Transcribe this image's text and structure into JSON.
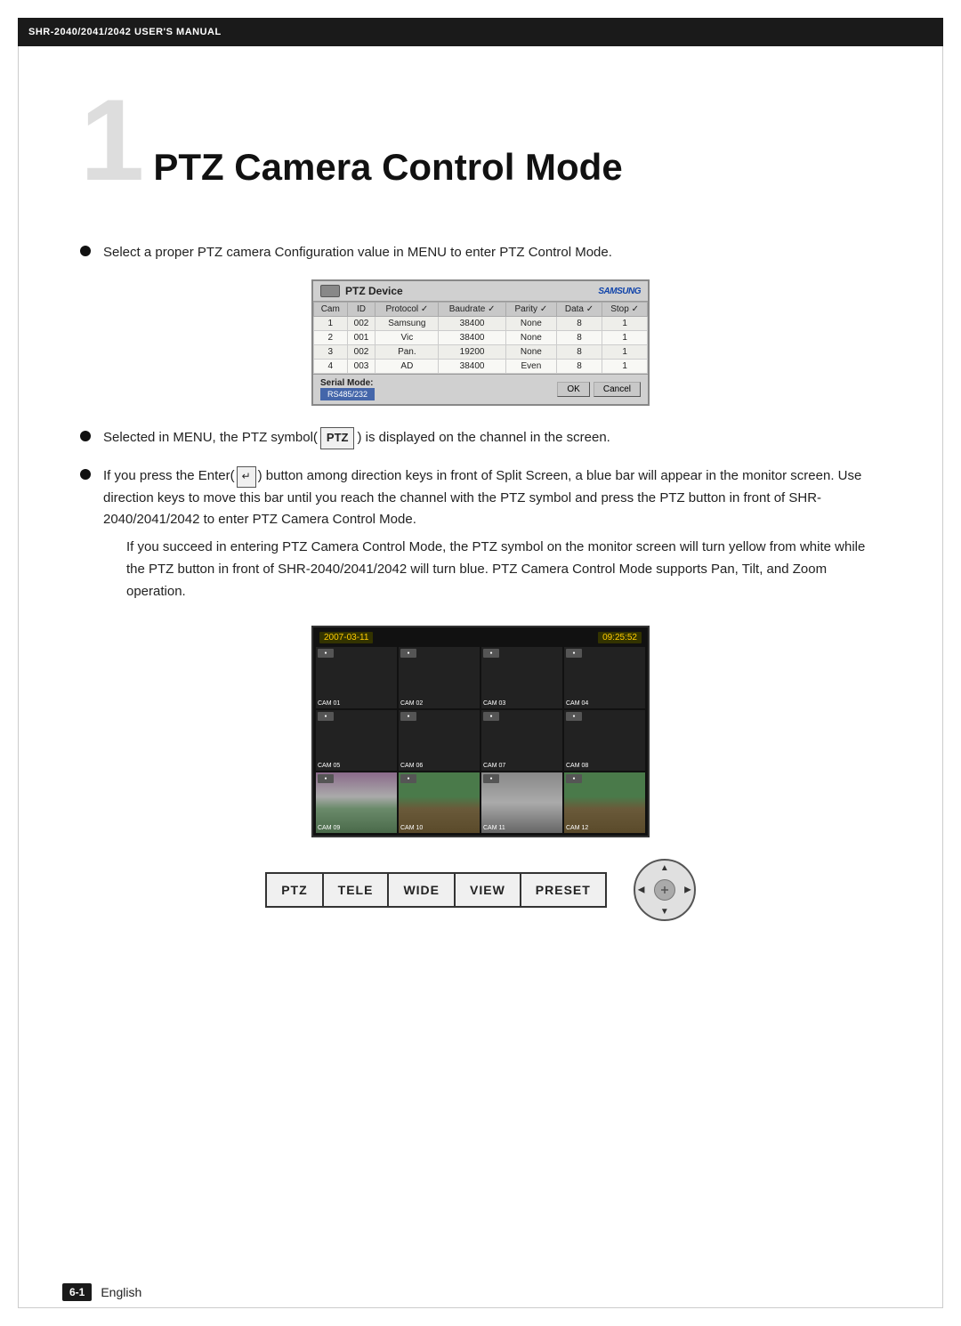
{
  "header": {
    "title": "SHR-2040/2041/2042 USER'S MANUAL"
  },
  "chapter": {
    "number": "1",
    "title": "PTZ Camera Control Mode"
  },
  "bullets": [
    {
      "id": "bullet1",
      "text": "Select a proper PTZ camera Configuration value in MENU to enter PTZ Control Mode."
    },
    {
      "id": "bullet2",
      "text_parts": [
        "Selected in MENU, the PTZ symbol(",
        "PTZ",
        ") is displayed on the channel in the screen."
      ]
    },
    {
      "id": "bullet3",
      "main": "If you press the Enter(",
      "enter_symbol": "↵",
      "main2": ") button among direction keys in front of Split Screen, a blue bar will appear in the monitor screen. Use direction keys to move this bar until you reach the channel with the PTZ symbol and press the PTZ button in front of SHR-2040/2041/2042 to enter PTZ Camera Control Mode.",
      "sub": "If you succeed in entering PTZ Camera Control Mode, the PTZ symbol on the monitor screen will turn yellow from white while the PTZ button in front of SHR-2040/2041/2042 will turn blue. PTZ Camera Control Mode supports Pan, Tilt, and Zoom operation."
    }
  ],
  "ptz_device_table": {
    "title": "PTZ Device",
    "samsung_logo": "SAMSUNG",
    "columns": [
      "Cam",
      "ID",
      "Protocol",
      "Baudrate",
      "Parity",
      "Data",
      "Stop"
    ],
    "rows": [
      [
        "1",
        "002",
        "Samsung",
        "38400",
        "None",
        "8",
        "1"
      ],
      [
        "2",
        "001",
        "Vic",
        "38400",
        "None",
        "8",
        "1"
      ],
      [
        "3",
        "002",
        "Pan.",
        "19200",
        "None",
        "8",
        "1"
      ],
      [
        "4",
        "003",
        "AD",
        "38400",
        "Even",
        "8",
        "1"
      ]
    ],
    "serial_mode_label": "Serial Mode:",
    "dropdown_label": "RS485/232",
    "ok_button": "OK",
    "cancel_button": "Cancel"
  },
  "camera_grid": {
    "date": "2007-03-11",
    "time": "09:25:52",
    "cameras": [
      {
        "id": "CAM 01",
        "type": "dark"
      },
      {
        "id": "CAM 02",
        "type": "dark"
      },
      {
        "id": "CAM 03",
        "type": "dark"
      },
      {
        "id": "CAM 04",
        "type": "dark"
      },
      {
        "id": "CAM 05",
        "type": "dark"
      },
      {
        "id": "CAM 06",
        "type": "dark"
      },
      {
        "id": "CAM 07",
        "type": "dark"
      },
      {
        "id": "CAM 08",
        "type": "dark"
      },
      {
        "id": "CAM 09",
        "type": "flowers"
      },
      {
        "id": "CAM 10",
        "type": "nature"
      },
      {
        "id": "CAM 11",
        "type": "street"
      },
      {
        "id": "CAM 12",
        "type": "nature"
      }
    ]
  },
  "control_buttons": {
    "labels": [
      "PTZ",
      "TELE",
      "WIDE",
      "VIEW",
      "PRESET"
    ]
  },
  "footer": {
    "page_badge": "6-1",
    "language": "English"
  }
}
